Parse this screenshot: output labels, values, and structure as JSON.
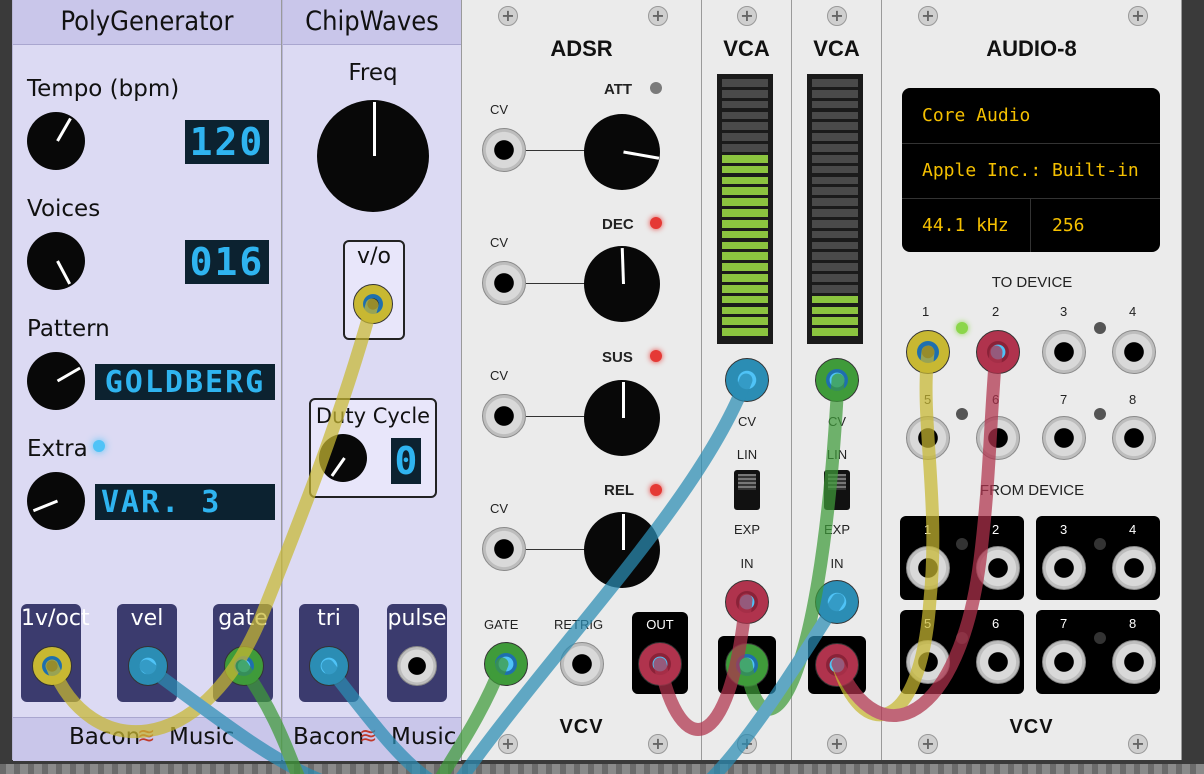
{
  "poly_generator": {
    "title": "PolyGenerator",
    "tempo_label": "Tempo (bpm)",
    "tempo_value": "120",
    "voices_label": "Voices",
    "voices_value": "016",
    "pattern_label": "Pattern",
    "pattern_value": "GOLDBERG",
    "extra_label": "Extra",
    "extra_value": "VAR. 3",
    "outputs": [
      "1v/oct",
      "vel",
      "gate"
    ],
    "brand": "Bacon",
    "brand2": "Music"
  },
  "chip_waves": {
    "title": "ChipWaves",
    "freq_label": "Freq",
    "vo_label": "v/o",
    "duty_label": "Duty Cycle",
    "duty_value": "0",
    "outputs": [
      "tri",
      "pulse"
    ],
    "brand": "Bacon",
    "brand2": "Music"
  },
  "adsr": {
    "title": "ADSR",
    "cv_label": "CV",
    "stages": [
      "ATT",
      "DEC",
      "SUS",
      "REL"
    ],
    "gate_label": "GATE",
    "retrig_label": "RETRIG",
    "out_label": "OUT",
    "logo": "VCV"
  },
  "vca1": {
    "title": "VCA",
    "cv_label": "CV",
    "lin_label": "LIN",
    "exp_label": "EXP",
    "in_label": "IN",
    "level": 0.72
  },
  "vca2": {
    "title": "VCA",
    "cv_label": "CV",
    "lin_label": "LIN",
    "exp_label": "EXP",
    "in_label": "IN",
    "level": 0.17
  },
  "audio8": {
    "title": "AUDIO-8",
    "driver": "Core Audio",
    "device": "Apple Inc.: Built-in",
    "sample_rate": "44.1 kHz",
    "block_size": "256",
    "to_device_label": "TO DEVICE",
    "from_device_label": "FROM DEVICE",
    "to_ports": [
      "1",
      "2",
      "3",
      "4",
      "5",
      "6",
      "7",
      "8"
    ],
    "from_ports": [
      "1",
      "2",
      "3",
      "4",
      "5",
      "6",
      "7",
      "8"
    ],
    "logo": "VCV"
  },
  "colors": {
    "cable_yellow": "#c8b832",
    "cable_green": "#3f9b3a",
    "cable_blue": "#2b8db4",
    "cable_red": "#b0334d",
    "lcd_blue": "#2fb4f0",
    "audio_amber": "#f5c000",
    "meter_green": "#8bc43f"
  }
}
